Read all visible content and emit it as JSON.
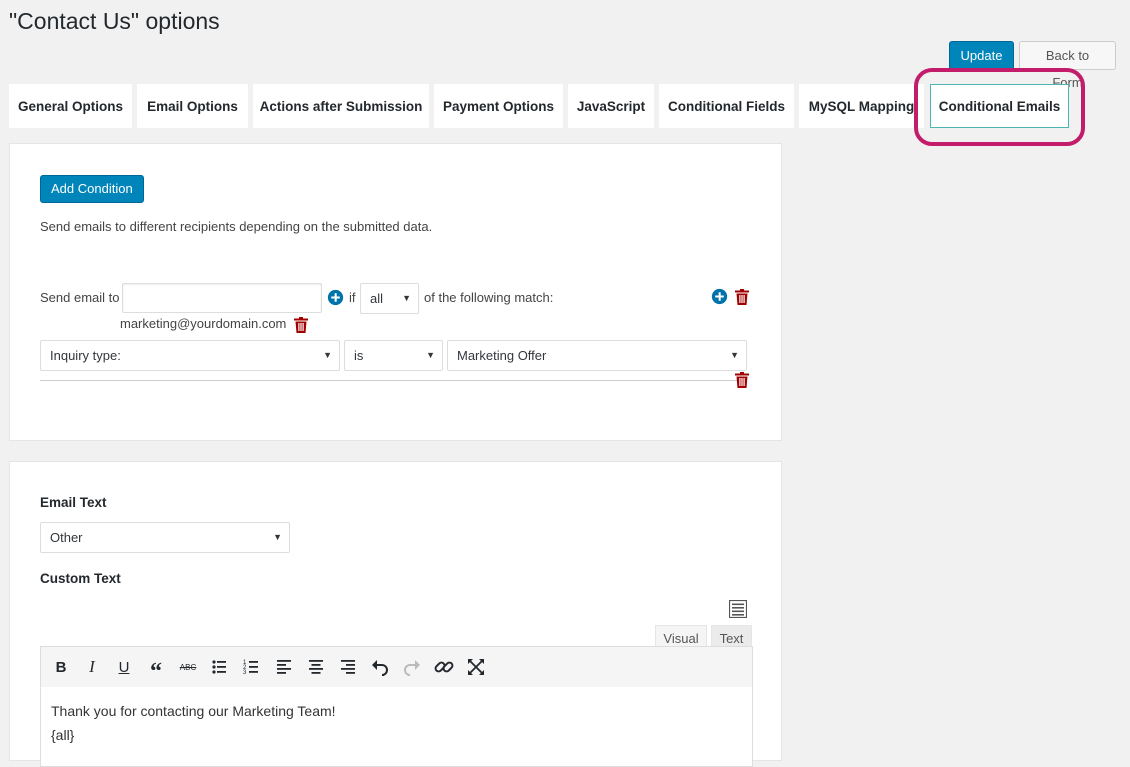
{
  "page": {
    "title": "\"Contact Us\" options"
  },
  "header_buttons": {
    "update": "Update",
    "back": "Back to Form"
  },
  "tabs": [
    {
      "label": "General Options"
    },
    {
      "label": "Email Options"
    },
    {
      "label": "Actions after Submission"
    },
    {
      "label": "Payment Options"
    },
    {
      "label": "JavaScript"
    },
    {
      "label": "Conditional Fields"
    },
    {
      "label": "MySQL Mapping"
    },
    {
      "label": "Conditional Emails",
      "active": true
    }
  ],
  "conditions": {
    "add_button": "Add Condition",
    "description": "Send emails to different recipients depending on the submitted data.",
    "send_email_label": "Send email to",
    "email_input_value": "",
    "if_label": "if",
    "match_select": "all",
    "following_label": "of the following match:",
    "recipient": "marketing@yourdomain.com",
    "rule": {
      "field": "Inquiry type:",
      "operator": "is",
      "value": "Marketing Offer"
    }
  },
  "email_text": {
    "label": "Email Text",
    "select_value": "Other",
    "custom_label": "Custom Text",
    "editor_tabs": {
      "visual": "Visual",
      "text": "Text"
    },
    "toolbar": [
      "bold-icon",
      "italic-icon",
      "underline-icon",
      "blockquote-icon",
      "strikethrough-icon",
      "bullet-list-icon",
      "numbered-list-icon",
      "align-left-icon",
      "align-center-icon",
      "align-right-icon",
      "undo-icon",
      "redo-icon",
      "link-icon",
      "fullscreen-icon"
    ],
    "body_line1": "Thank you for contacting our Marketing Team!",
    "body_line2": "{all}"
  },
  "colors": {
    "primary": "#0085ba",
    "delete": "#a00000",
    "highlight": "#c21c6a",
    "active_tab_border": "#4eb3b3"
  }
}
